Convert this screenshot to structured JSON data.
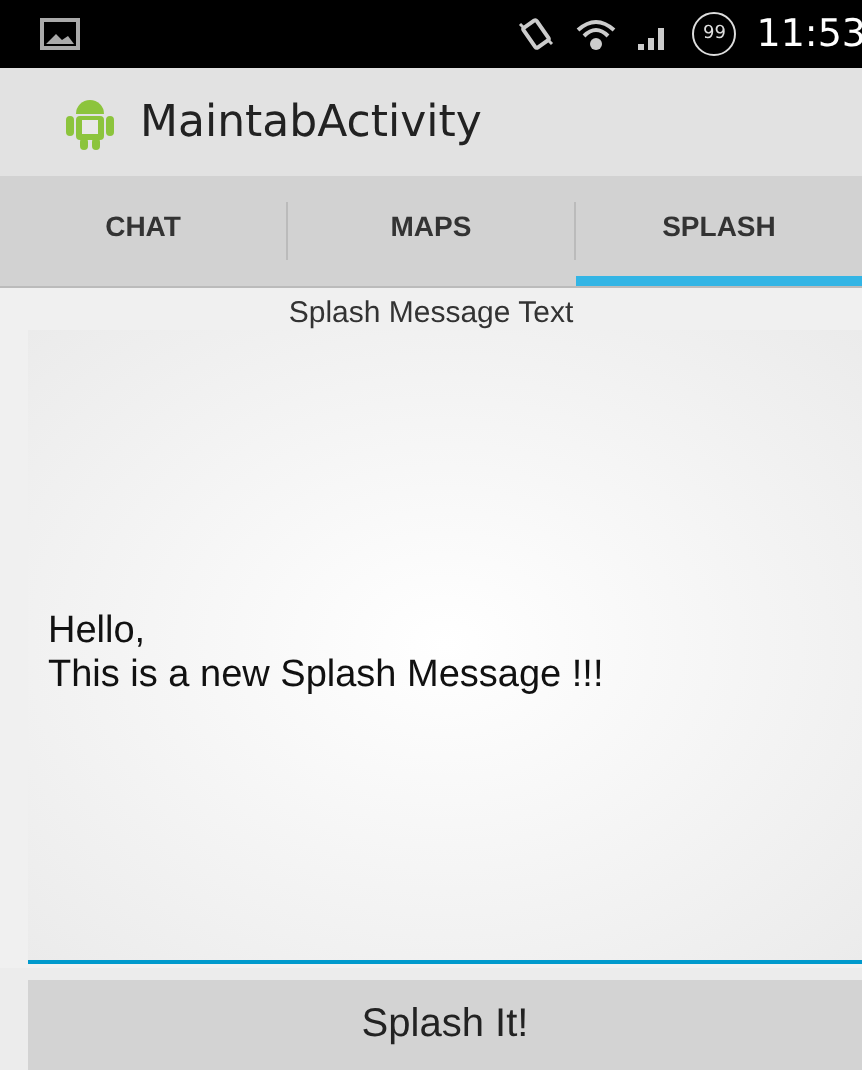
{
  "status_bar": {
    "battery": "99",
    "time": "11:53"
  },
  "action_bar": {
    "title": "MaintabActivity"
  },
  "tabs": [
    {
      "label": "CHAT",
      "selected": false
    },
    {
      "label": "MAPS",
      "selected": false
    },
    {
      "label": "SPLASH",
      "selected": true
    }
  ],
  "label": "Splash Message Text",
  "message_field": {
    "value": "Hello,\nThis is a new Splash Message !!!"
  },
  "button": "Splash It!"
}
